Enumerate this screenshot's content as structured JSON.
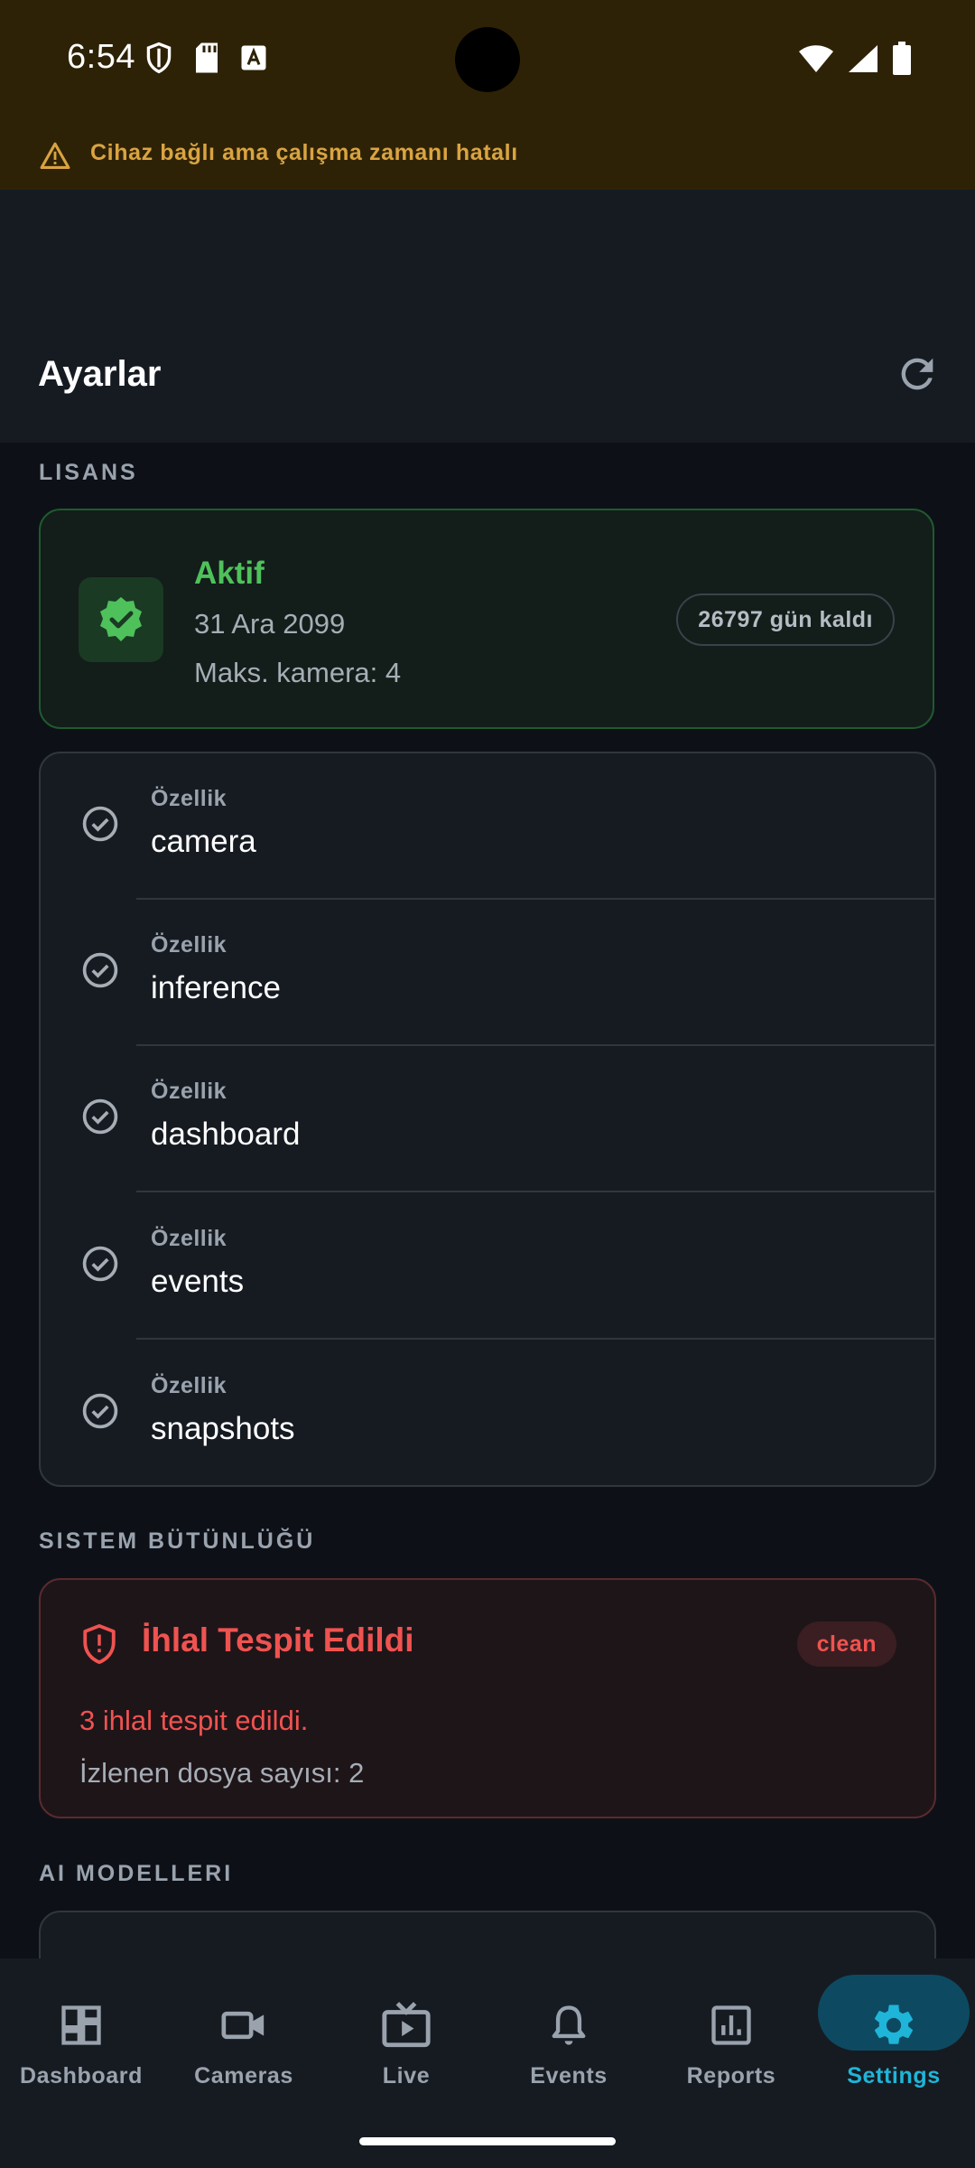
{
  "status_bar": {
    "time": "6:54"
  },
  "banner": {
    "text": "Cihaz bağlı ama çalışma zamanı hatalı",
    "color": "#d9a441"
  },
  "app_bar": {
    "title": "Ayarlar"
  },
  "license_section": {
    "label": "LISANS",
    "status": "Aktif",
    "expiry_date": "31 Ara 2099",
    "max_cameras": "Maks. kamera: 4",
    "days_left": "26797 gün kaldı",
    "status_color": "#4fc15b"
  },
  "features": [
    {
      "label": "Özellik",
      "value": "camera"
    },
    {
      "label": "Özellik",
      "value": "inference"
    },
    {
      "label": "Özellik",
      "value": "dashboard"
    },
    {
      "label": "Özellik",
      "value": "events"
    },
    {
      "label": "Özellik",
      "value": "snapshots"
    }
  ],
  "integrity_section": {
    "label": "SISTEM BÜTÜNLÜĞÜ",
    "title": "İhlal Tespit Edildi",
    "chip": "clean",
    "violations": "3 ihlal tespit edildi.",
    "monitored_files": "İzlenen dosya sayısı: 2",
    "alert_color": "#ef5350"
  },
  "models_section": {
    "label": "AI MODELLERI"
  },
  "bottom_nav": {
    "items": [
      {
        "label": "Dashboard",
        "icon": "dashboard-icon"
      },
      {
        "label": "Cameras",
        "icon": "videocam-icon"
      },
      {
        "label": "Live",
        "icon": "live-tv-icon"
      },
      {
        "label": "Events",
        "icon": "bell-icon"
      },
      {
        "label": "Reports",
        "icon": "bar-chart-icon"
      },
      {
        "label": "Settings",
        "icon": "gear-icon"
      }
    ],
    "active": "Settings",
    "accent_color": "#1fb5d8"
  }
}
